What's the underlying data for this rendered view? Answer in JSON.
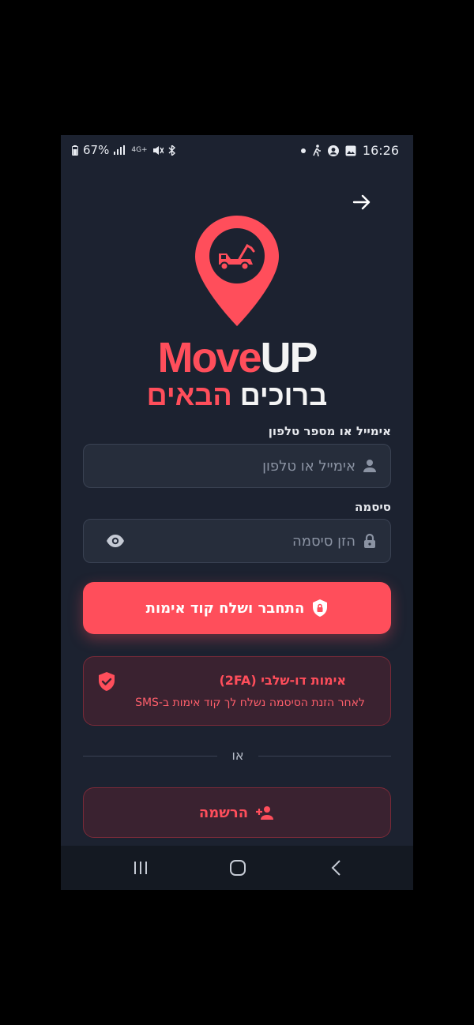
{
  "status_bar": {
    "battery": "67%",
    "time": "16:26",
    "network": "4G+",
    "icons": [
      "battery-icon",
      "signal-icon",
      "mute-icon",
      "bluetooth-icon",
      "dot-icon",
      "walk-icon",
      "account-icon",
      "image-icon"
    ]
  },
  "header": {
    "back_icon": "arrow-right-icon"
  },
  "brand": {
    "logo_icon": "tow-truck-pin-icon",
    "name_part1": "Move",
    "name_part2": "UP",
    "welcome_white": "ברוכים",
    "welcome_red": "הבאים"
  },
  "form": {
    "email": {
      "label": "אימייל או מספר טלפון",
      "placeholder": "אימייל או טלפון",
      "icon": "person-icon"
    },
    "password": {
      "label": "סיסמה",
      "placeholder": "הזן סיסמה",
      "icon": "lock-icon",
      "toggle_icon": "eye-icon"
    },
    "submit_label": "התחבר ושלח קוד אימות",
    "submit_icon": "shield-lock-icon"
  },
  "twofa": {
    "title": "אימות דו-שלבי (2FA)",
    "subtitle": "לאחר הזנת הסיסמה נשלח לך קוד אימות ב-SMS",
    "icon": "shield-check-icon"
  },
  "divider_text": "או",
  "register": {
    "label": "הרשמה",
    "icon": "person-add-icon"
  },
  "nav": {
    "recents_icon": "recents-icon",
    "home_icon": "home-icon",
    "back_icon": "back-chevron-icon"
  },
  "colors": {
    "background": "#1c2230",
    "accent": "#ff4e5b",
    "field": "#262d3b",
    "alert_bg": "#3a2230"
  }
}
